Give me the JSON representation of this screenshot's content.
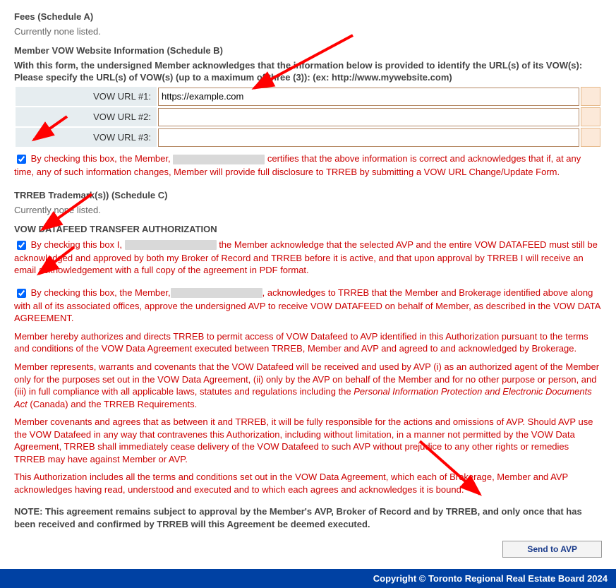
{
  "fees": {
    "heading": "Fees (Schedule A)",
    "status": "Currently none listed."
  },
  "vow_section": {
    "heading": "Member VOW Website Information (Schedule B)",
    "intro_line1": "With this form, the undersigned Member acknowledges that the information below is provided to identify the URL(s) of its VOW(s):",
    "intro_line2": "Please specify the URL(s) of VOW(s) (up to a maximum of three (3)): (ex: http://www.mywebsite.com)",
    "labels": {
      "url1": "VOW URL #1:",
      "url2": "VOW URL #2:",
      "url3": "VOW URL #3:"
    },
    "values": {
      "url1": "https://example.com",
      "url2": "",
      "url3": ""
    },
    "cert_before": "By checking this box, the Member, ",
    "cert_after": " certifies that the above information is correct and acknowledges that if, at any time, any of such information changes, Member will provide full disclosure to TRREB by submitting a VOW URL Change/Update Form."
  },
  "trademark": {
    "heading": "TRREB Trademark(s)) (Schedule C)",
    "status": "Currently none listed."
  },
  "datafeed": {
    "heading": "VOW DATAFEED TRANSFER AUTHORIZATION",
    "ack1_before": "By checking this box I, ",
    "ack1_after": " the Member acknowledge that the selected AVP and the entire VOW DATAFEED must still be acknowledged and approved by both my Broker of Record and TRREB before it is active, and that upon approval by TRREB I will receive an email acknowledgement with a full copy of the agreement in PDF format.",
    "ack2_before": "By checking this box, the Member,",
    "ack2_after": ", acknowledges to TRREB that the Member and Brokerage identified above along with all of its associated offices, approve the undersigned AVP to receive VOW DATAFEED on behalf of Member, as described in the VOW DATA AGREEMENT.",
    "para_authorize": "Member hereby authorizes and directs TRREB to permit access of VOW Datafeed to AVP identified in this Authorization pursuant to the terms and conditions of the VOW Data Agreement executed between TRREB, Member and AVP and agreed to and acknowledged by Brokerage.",
    "para_represents_1": "Member represents, warrants and covenants that the VOW Datafeed will be received and used by AVP (i) as an authorized agent of the Member only for the purposes set out in the VOW Data Agreement, (ii) only by the AVP on behalf of the Member and for no other purpose or person, and (iii) in full compliance with all applicable laws, statutes and regulations including the ",
    "para_represents_italic": "Personal Information Protection and Electronic Documents Act",
    "para_represents_2": " (Canada) and the TRREB Requirements.",
    "para_covenants": "Member covenants and agrees that as between it and TRREB, it will be fully responsible for the actions and omissions of AVP. Should AVP use the VOW Datafeed in any way that contravenes this Authorization, including without limitation, in a manner not permitted by the VOW Data Agreement, TRREB shall immediately cease delivery of the VOW Datafeed to such AVP without prejudice to any other rights or remedies TRREB may have against Member or AVP.",
    "para_auth_includes": "This Authorization includes all the terms and conditions set out in the VOW Data Agreement, which each of Brokerage, Member and AVP acknowledges having read, understood and executed and to which each agrees and acknowledges it is bound."
  },
  "note": {
    "text": "NOTE: This agreement remains subject to approval by the Member's AVP, Broker of Record and by TRREB, and only once that has been received and confirmed by TRREB will this Agreement be deemed executed."
  },
  "button": {
    "send_label": "Send to AVP"
  },
  "footer": {
    "copyright": "Copyright © Toronto Regional Real Estate Board 2024"
  }
}
